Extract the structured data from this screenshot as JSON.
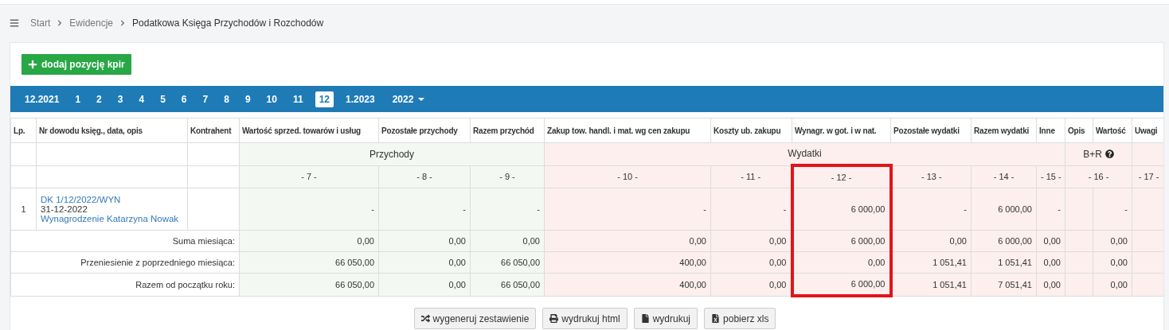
{
  "breadcrumb": [
    {
      "label": "Start",
      "current": false
    },
    {
      "label": "Ewidencje",
      "current": false
    },
    {
      "label": "Podatkowa Księga Przychodów i Rozchodów",
      "current": true
    }
  ],
  "add_button": {
    "label": "dodaj pozycję kpir"
  },
  "periods": [
    {
      "label": "12.2021",
      "selected": false
    },
    {
      "label": "1",
      "selected": false
    },
    {
      "label": "2",
      "selected": false
    },
    {
      "label": "3",
      "selected": false
    },
    {
      "label": "4",
      "selected": false
    },
    {
      "label": "5",
      "selected": false
    },
    {
      "label": "6",
      "selected": false
    },
    {
      "label": "7",
      "selected": false
    },
    {
      "label": "8",
      "selected": false
    },
    {
      "label": "9",
      "selected": false
    },
    {
      "label": "10",
      "selected": false
    },
    {
      "label": "11",
      "selected": false
    },
    {
      "label": "12",
      "selected": true
    },
    {
      "label": "1.2023",
      "selected": false
    }
  ],
  "year_dropdown": {
    "label": "2022"
  },
  "table": {
    "groups": [
      {
        "kind": "blank",
        "columns": [
          {
            "label": "Lp.",
            "highlighted": false
          },
          {
            "label": "Nr dowodu księg., data, opis",
            "highlighted": false
          },
          {
            "label": "Kontrahent",
            "highlighted": false
          }
        ]
      },
      {
        "kind": "income",
        "label": "Przychody",
        "columns": [
          {
            "label": "Wartość sprzed. towarów i usług",
            "number": "- 7 -",
            "highlighted": false
          },
          {
            "label": "Pozostałe przychody",
            "number": "- 8 -",
            "highlighted": false
          },
          {
            "label": "Razem przychód",
            "number": "- 9 -",
            "highlighted": false
          }
        ]
      },
      {
        "kind": "expense",
        "label": "Wydatki",
        "columns": [
          {
            "label": "Zakup tow. handl. i mat. wg cen zakupu",
            "number": "- 10 -",
            "highlighted": false
          },
          {
            "label": "Koszty ub. zakupu",
            "number": "- 11 -",
            "highlighted": false
          },
          {
            "label": "Wynagr. w got. i w nat.",
            "number": "- 12 -",
            "highlighted": true
          },
          {
            "label": "Pozostałe wydatki",
            "number": "- 13 -",
            "highlighted": false
          },
          {
            "label": "Razem wydatki",
            "number": "- 14 -",
            "highlighted": false
          },
          {
            "label": "Inne",
            "number": "- 15 -",
            "highlighted": false
          }
        ]
      },
      {
        "kind": "expense",
        "label": "B+R",
        "help": true,
        "number": "- 16 -",
        "columns": [
          {
            "label": "Opis",
            "highlighted": false
          },
          {
            "label": "Wartość",
            "highlighted": false
          }
        ]
      },
      {
        "kind": "expense",
        "number": "- 17 -",
        "columns": [
          {
            "label": "Uwagi",
            "highlighted": false
          }
        ]
      }
    ],
    "rows": [
      {
        "kind": "entry",
        "lp": "1",
        "document": "DK 1/12/2022/WYN",
        "date": "31-12-2022",
        "description": "Wynagrodzenie Katarzyna Nowak",
        "values": [
          "-",
          "-",
          "-",
          "-",
          "-",
          "6 000,00",
          "-",
          "6 000,00",
          "-"
        ],
        "rd_value": "-"
      },
      {
        "kind": "summary",
        "label": "Suma miesiąca:",
        "values": [
          "0,00",
          "0,00",
          "0,00",
          "0,00",
          "0,00",
          "6 000,00",
          "0,00",
          "6 000,00",
          "0,00"
        ],
        "rd_value": "0,00"
      },
      {
        "kind": "summary",
        "label": "Przeniesienie z poprzedniego miesiąca:",
        "values": [
          "66 050,00",
          "0,00",
          "66 050,00",
          "400,00",
          "0,00",
          "0,00",
          "1 051,41",
          "1 051,41",
          "0,00"
        ],
        "rd_value": "0,00"
      },
      {
        "kind": "summary",
        "label": "Razem od początku roku:",
        "values": [
          "66 050,00",
          "0,00",
          "66 050,00",
          "400,00",
          "0,00",
          "6 000,00",
          "1 051,41",
          "7 051,41",
          "0,00"
        ],
        "rd_value": "0,00"
      }
    ]
  },
  "footer_buttons": [
    {
      "kind": "shuffle",
      "label": "wygeneruj zestawienie"
    },
    {
      "kind": "print",
      "label": "wydrukuj html"
    },
    {
      "kind": "file",
      "label": "wydrukuj"
    },
    {
      "kind": "excel",
      "label": "pobierz xls"
    }
  ]
}
